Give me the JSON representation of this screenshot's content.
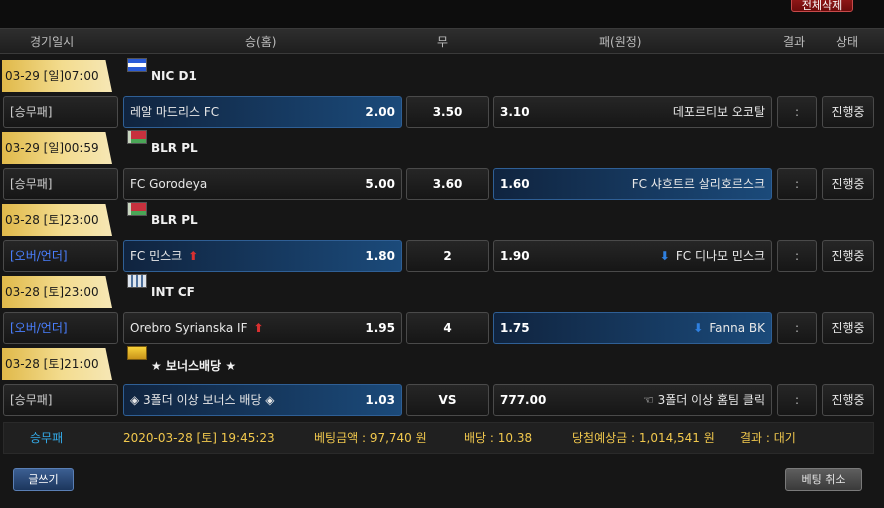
{
  "top": {
    "delete_all_label": "전체삭제"
  },
  "headers": {
    "date": "경기일시",
    "home": "승(홈)",
    "draw": "무",
    "away": "패(원정)",
    "result": "결과",
    "status": "상태"
  },
  "games": [
    {
      "date": "03-29 [일]07:00",
      "league": "NIC D1",
      "flag_icon": "nicaragua-flag-icon",
      "type": "[승무패]",
      "home": "레알 마드리스 FC",
      "home_odd": "2.00",
      "draw": "3.50",
      "away_odd": "3.10",
      "away": "데포르티보 오코탈",
      "result": ":",
      "status": "진행중",
      "selected": "home"
    },
    {
      "date": "03-29 [일]00:59",
      "league": "BLR PL",
      "flag_icon": "belarus-flag-icon",
      "type": "[승무패]",
      "home": "FC Gorodeya",
      "home_odd": "5.00",
      "draw": "3.60",
      "away_odd": "1.60",
      "away": "FC 샤흐트르 살리호르스크",
      "result": ":",
      "status": "진행중",
      "selected": "away"
    },
    {
      "date": "03-28 [토]23:00",
      "league": "BLR PL",
      "flag_icon": "belarus-flag-icon",
      "type": "[오버/언더]",
      "home": "FC 민스크",
      "home_odd": "1.80",
      "draw": "2",
      "away_odd": "1.90",
      "away": "FC 디나모 민스크",
      "result": ":",
      "status": "진행중",
      "selected": "home"
    },
    {
      "date": "03-28 [토]23:00",
      "league": "INT CF",
      "flag_icon": "international-flag-icon",
      "type": "[오버/언더]",
      "home": "Orebro Syrianska IF",
      "home_odd": "1.95",
      "draw": "4",
      "away_odd": "1.75",
      "away": "Fanna BK",
      "result": ":",
      "status": "진행중",
      "selected": "away"
    },
    {
      "date": "03-28 [토]21:00",
      "league": "★ 보너스배당 ★",
      "flag_icon": "bonus-badge-icon",
      "type": "[승무패]",
      "home": "◈ 3폴더 이상 보너스 배당 ◈",
      "home_odd": "1.03",
      "draw": "VS",
      "away_odd": "777.00",
      "away": "☜ 3폴더 이상 홈팀 클릭",
      "result": ":",
      "status": "진행중",
      "selected": "home"
    }
  ],
  "summary": {
    "type": "승무패",
    "datetime": "2020-03-28 [토] 19:45:23",
    "bet_amount": "베팅금액 : 97,740 원",
    "odds": "배당 : 10.38",
    "expected_win": "당첨예상금 : 1,014,541 원",
    "result": "결과 : 대기"
  },
  "footer": {
    "write_label": "글쓰기",
    "cancel_label": "베팅 취소"
  },
  "colors": {
    "date_tag": "#f3dc8f",
    "selected_cell": "#1b4a7a",
    "summary_text": "#f1c84d",
    "summary_type": "#33a9e6",
    "ou_type": "#4a7fff",
    "arrow_up": "#d93030",
    "arrow_down": "#2f80e0"
  }
}
